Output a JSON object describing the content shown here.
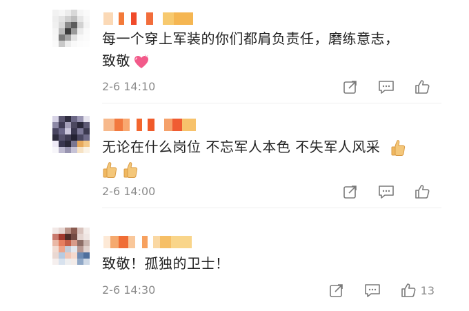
{
  "comments": [
    {
      "text": "每一个穿上军装的你们都肩负责任，磨练意志，",
      "text2": "致敬",
      "emoji": "heart-emoji",
      "timestamp": "2-6 14:10",
      "like_count": ""
    },
    {
      "text": "无论在什么岗位 不忘军人本色 不失军人风采",
      "emoji": "thumbs-up-emoji",
      "timestamp": "2-6 14:00",
      "like_count": ""
    },
    {
      "text": "致敬！孤独的卫士！",
      "timestamp": "2-6 14:30",
      "like_count": "13"
    }
  ],
  "icons": {
    "forward": "share-icon",
    "comment": "comment-icon",
    "like": "like-icon"
  },
  "colors": {
    "text": "#222222",
    "meta": "#8c8c8c",
    "icon": "#7a7a7a",
    "divider": "#eeeeee"
  }
}
